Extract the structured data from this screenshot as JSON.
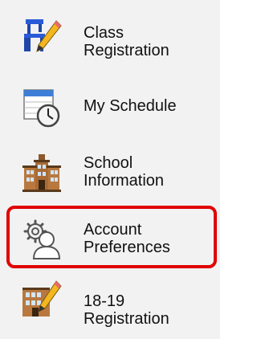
{
  "nav": {
    "items": [
      {
        "key": "class-registration",
        "lines": [
          "Class",
          "Registration"
        ],
        "icon": "desk-pencil-icon"
      },
      {
        "key": "my-schedule",
        "lines": [
          "My Schedule"
        ],
        "icon": "calendar-clock-icon"
      },
      {
        "key": "school-information",
        "lines": [
          "School",
          "Information"
        ],
        "icon": "school-building-icon"
      },
      {
        "key": "account-preferences",
        "lines": [
          "Account",
          "Preferences"
        ],
        "icon": "user-gear-icon",
        "highlighted": true
      },
      {
        "key": "registration-18-19",
        "lines": [
          "18-19",
          "Registration"
        ],
        "icon": "building-pencil-icon"
      }
    ],
    "highlight_color": "#e00000",
    "background_color": "#f2f2f2"
  }
}
